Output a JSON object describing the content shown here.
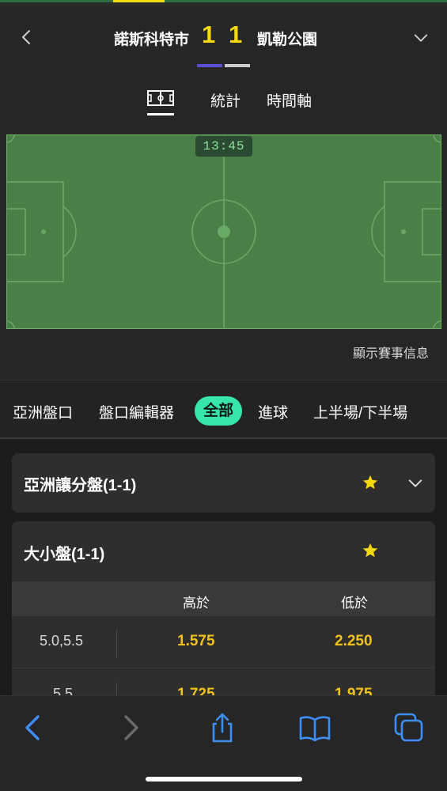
{
  "match": {
    "home_team": "諾斯科特市",
    "away_team": "凱勒公園",
    "home_score": "1",
    "away_score": "1",
    "clock": "13:45"
  },
  "tabs": {
    "pitch_icon": "pitch-icon",
    "stats": "統計",
    "timeline": "時間軸"
  },
  "pitch": {
    "show_info": "顯示賽事信息"
  },
  "markets": {
    "items": [
      "亞洲盤口",
      "盤口編輯器",
      "全部",
      "進球",
      "上半場/下半場"
    ],
    "active_index": 2
  },
  "cards": [
    {
      "title": "亞洲讓分盤(1-1)",
      "collapsed": true
    },
    {
      "title": "大小盤(1-1)",
      "header_over": "高於",
      "header_under": "低於",
      "rows": [
        {
          "line": "5.0,5.5",
          "over": "1.575",
          "under": "2.250"
        },
        {
          "line": "5.5",
          "over": "1.725",
          "under": "1.975"
        }
      ]
    }
  ],
  "colors": {
    "accent": "#f5d90a",
    "active_pill": "#39e6a9",
    "pitch": "#4a7f48",
    "odds": "#f2c21a"
  }
}
